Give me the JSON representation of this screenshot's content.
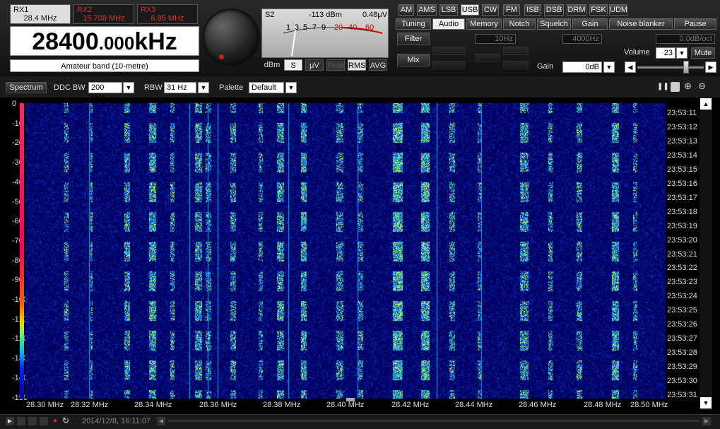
{
  "receivers": [
    {
      "name": "RX1",
      "freq": "28.4 MHz"
    },
    {
      "name": "RX2",
      "freq": "15.708 MHz"
    },
    {
      "name": "RX3",
      "freq": "6.85 MHz"
    }
  ],
  "frequency": {
    "main": "28400",
    "decimals": ".000",
    "unit": "kHz"
  },
  "band": "Amateur band (10-metre)",
  "meter": {
    "label": "S2",
    "dbm": "-113 dBm",
    "uv": "0.48μV",
    "scale": [
      "1",
      "3",
      "5",
      "7",
      "9",
      "20",
      "40",
      "60"
    ],
    "buttons": [
      "dBm",
      "S",
      "μV",
      "Peak",
      "RMS",
      "AVG"
    ]
  },
  "modes": [
    "AM",
    "AMS",
    "LSB",
    "USB",
    "CW",
    "FM",
    "ISB",
    "DSB",
    "DRM",
    "FSK",
    "UDM"
  ],
  "selected_mode": "USB",
  "tabs": [
    "Tuning",
    "Audio",
    "Memory",
    "Notch",
    "Squelch",
    "Gain",
    "Noise blanker",
    "Pause"
  ],
  "selected_tab": "Audio",
  "audio": {
    "filter_label": "Filter",
    "filter_low": "10Hz",
    "filter_high": "4000Hz",
    "slope": "0.0dB/oct",
    "mix_label": "Mix",
    "gain_label": "Gain",
    "gain_value": "0dB",
    "volume_label": "Volume",
    "volume_value": "23",
    "volume_level": 0.75,
    "mute_label": "Mute"
  },
  "toolbar": {
    "spectrum_button": "Spectrum",
    "ddc_label": "DDC BW",
    "ddc_value": "200 kHz",
    "rbw_label": "RBW",
    "rbw_value": "31 Hz",
    "palette_label": "Palette",
    "palette_value": "Default"
  },
  "y_axis": [
    "0",
    "-10",
    "-20",
    "-30",
    "-40",
    "-50",
    "-60",
    "-70",
    "-80",
    "-90",
    "-100",
    "-110",
    "-120",
    "-130",
    "-140",
    "-150"
  ],
  "x_axis": [
    "28.30 MHz",
    "28.32 MHz",
    "28.34 MHz",
    "28.36 MHz",
    "28.38 MHz",
    "28.40 MHz",
    "28.42 MHz",
    "28.44 MHz",
    "28.46 MHz",
    "28.48 MHz",
    "28.50 MHz"
  ],
  "time_axis": [
    "23:53:11",
    "23:53:12",
    "23:53:13",
    "23:53:14",
    "23:53:15",
    "23:53:16",
    "23:53:17",
    "23:53:18",
    "23:53:19",
    "23:53:20",
    "23:53:21",
    "23:53:22",
    "23:53:23",
    "23:53:24",
    "23:53:25",
    "23:53:26",
    "23:53:27",
    "23:53:28",
    "23:53:29",
    "23:53:30",
    "23:53:31"
  ],
  "status": {
    "timestamp": "2014/12/8, 16:11:07"
  },
  "colors": {
    "background": "#000000",
    "waterfall_bg": "#00005a",
    "accent": "#cc2222"
  }
}
